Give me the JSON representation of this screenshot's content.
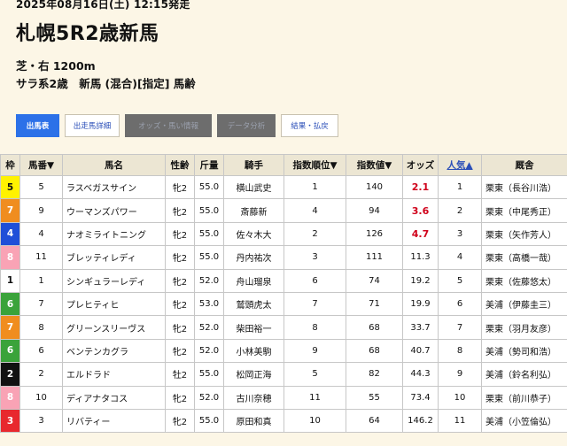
{
  "race": {
    "datetime": "2025年08月16日(土) 12:15発走",
    "title": "札幌5R2歳新馬",
    "course": "芝・右 1200m",
    "conditions": "サラ系2歳　新馬 (混合)[指定] 馬齢"
  },
  "tabs": [
    {
      "label": "出馬表"
    },
    {
      "label": "出走馬詳細"
    },
    {
      "label": "オッズ・馬い情報"
    },
    {
      "label": "データ分析"
    },
    {
      "label": "結果・払戻"
    }
  ],
  "table": {
    "headers": {
      "frame": "枠",
      "number": "馬番▼",
      "horse": "馬名",
      "sexage": "性齢",
      "weight": "斤量",
      "jockey": "騎手",
      "index_rank": "指数順位▼",
      "index_value": "指数値▼",
      "odds": "オッズ",
      "popularity": "人気▲",
      "stable": "厩舎"
    },
    "rows": [
      {
        "frame": "5",
        "number": "5",
        "horse": "ラスベガスサイン",
        "sexage": "牝2",
        "weight": "55.0",
        "jockey": "横山武史",
        "index_rank": "1",
        "index_value": "140",
        "odds": "2.1",
        "popularity": "1",
        "stable": "栗東（長谷川浩）"
      },
      {
        "frame": "7",
        "number": "9",
        "horse": "ウーマンズパワー",
        "sexage": "牝2",
        "weight": "55.0",
        "jockey": "斎藤新",
        "index_rank": "4",
        "index_value": "94",
        "odds": "3.6",
        "popularity": "2",
        "stable": "栗東（中尾秀正）"
      },
      {
        "frame": "4",
        "number": "4",
        "horse": "ナオミライトニング",
        "sexage": "牝2",
        "weight": "55.0",
        "jockey": "佐々木大",
        "index_rank": "2",
        "index_value": "126",
        "odds": "4.7",
        "popularity": "3",
        "stable": "栗東（矢作芳人）"
      },
      {
        "frame": "8",
        "number": "11",
        "horse": "ブレッティレディ",
        "sexage": "牝2",
        "weight": "55.0",
        "jockey": "丹内祐次",
        "index_rank": "3",
        "index_value": "111",
        "odds": "11.3",
        "popularity": "4",
        "stable": "栗東（高橋一哉）"
      },
      {
        "frame": "1",
        "number": "1",
        "horse": "シンギュラーレディ",
        "sexage": "牝2",
        "weight": "52.0",
        "jockey": "舟山瑠泉",
        "index_rank": "6",
        "index_value": "74",
        "odds": "19.2",
        "popularity": "5",
        "stable": "栗東（佐藤悠太）"
      },
      {
        "frame": "6",
        "number": "7",
        "horse": "プレヒティヒ",
        "sexage": "牝2",
        "weight": "53.0",
        "jockey": "鷲頭虎太",
        "index_rank": "7",
        "index_value": "71",
        "odds": "19.9",
        "popularity": "6",
        "stable": "美浦（伊藤圭三）"
      },
      {
        "frame": "7",
        "number": "8",
        "horse": "グリーンスリーヴス",
        "sexage": "牝2",
        "weight": "52.0",
        "jockey": "柴田裕一",
        "index_rank": "8",
        "index_value": "68",
        "odds": "33.7",
        "popularity": "7",
        "stable": "栗東（羽月友彦）"
      },
      {
        "frame": "6",
        "number": "6",
        "horse": "ベンテンカグラ",
        "sexage": "牝2",
        "weight": "52.0",
        "jockey": "小林美駒",
        "index_rank": "9",
        "index_value": "68",
        "odds": "40.7",
        "popularity": "8",
        "stable": "美浦（勢司和浩）"
      },
      {
        "frame": "2",
        "number": "2",
        "horse": "エルドラド",
        "sexage": "牡2",
        "weight": "55.0",
        "jockey": "松岡正海",
        "index_rank": "5",
        "index_value": "82",
        "odds": "44.3",
        "popularity": "9",
        "stable": "美浦（鈴名利弘）"
      },
      {
        "frame": "8",
        "number": "10",
        "horse": "ディアナタコス",
        "sexage": "牝2",
        "weight": "52.0",
        "jockey": "古川奈穂",
        "index_rank": "11",
        "index_value": "55",
        "odds": "73.4",
        "popularity": "10",
        "stable": "栗東（前川恭子）"
      },
      {
        "frame": "3",
        "number": "3",
        "horse": "リバティー",
        "sexage": "牝2",
        "weight": "55.0",
        "jockey": "原田和真",
        "index_rank": "10",
        "index_value": "64",
        "odds": "146.2",
        "popularity": "11",
        "stable": "美浦（小笠倫弘）"
      }
    ]
  },
  "colors": {
    "background": "#fcf6e6",
    "header_bg": "#ece6d3",
    "active_tab": "#2c71e8",
    "disabled_tab": "#6d6d6d",
    "odds_highlight": "#d0021b",
    "frame_colors": {
      "1": "#ffffff",
      "2": "#111111",
      "3": "#e8282e",
      "4": "#1f4fd8",
      "5": "#fff200",
      "6": "#3aa33a",
      "7": "#f08d1f",
      "8": "#f9a3b5"
    }
  }
}
